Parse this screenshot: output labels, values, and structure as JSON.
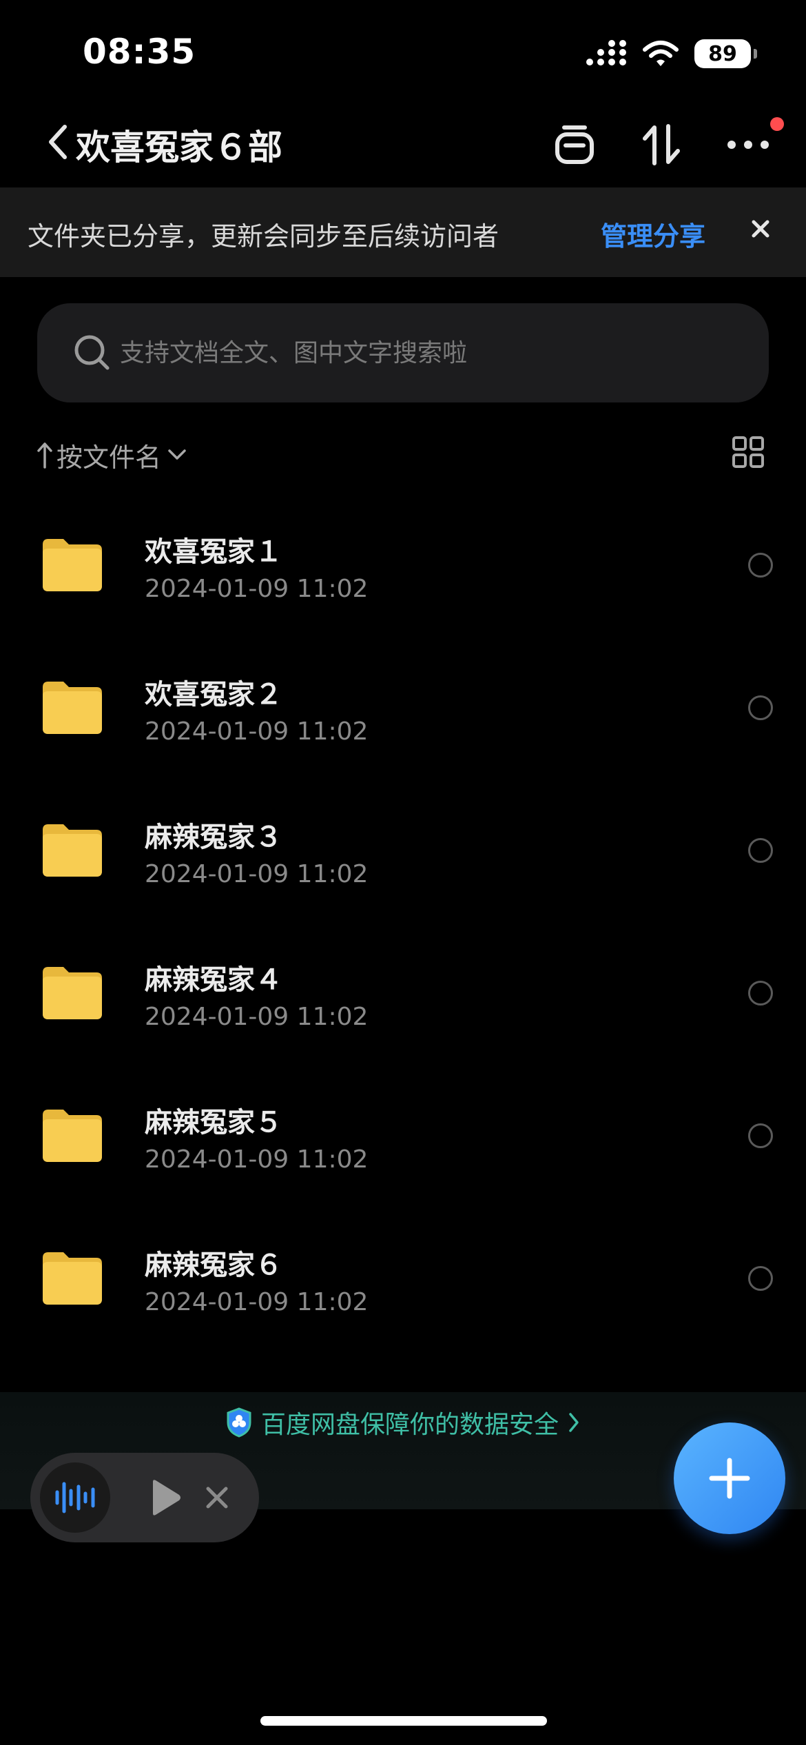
{
  "status_bar": {
    "time": "08:35",
    "battery": "89"
  },
  "nav": {
    "title": "欢喜冤家６部"
  },
  "share_banner": {
    "text": "文件夹已分享，更新会同步至后续访问者",
    "manage_label": "管理分享"
  },
  "search": {
    "placeholder": "支持文档全文、图中文字搜索啦"
  },
  "sort": {
    "label": "按文件名"
  },
  "files": [
    {
      "name": "欢喜冤家１",
      "date": "2024-01-09 11:02"
    },
    {
      "name": "欢喜冤家２",
      "date": "2024-01-09 11:02"
    },
    {
      "name": "麻辣冤家３",
      "date": "2024-01-09 11:02"
    },
    {
      "name": "麻辣冤家４",
      "date": "2024-01-09 11:02"
    },
    {
      "name": "麻辣冤家５",
      "date": "2024-01-09 11:02"
    },
    {
      "name": "麻辣冤家６",
      "date": "2024-01-09 11:02"
    }
  ],
  "security": {
    "text": "百度网盘保障你的数据安全"
  },
  "colors": {
    "accent": "#3a8ef6",
    "folder": "#f8cd52",
    "security": "#3fbfa6",
    "badge": "#ff4d4f"
  }
}
